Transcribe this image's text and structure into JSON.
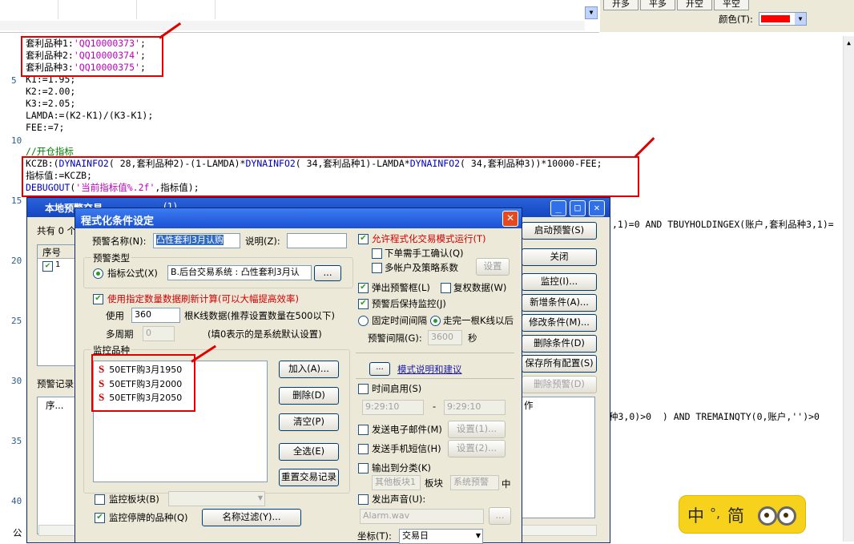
{
  "top_tabs": [
    "开多",
    "平多",
    "开空",
    "平空"
  ],
  "color_label": "颜色(T):",
  "colors": {
    "code_string": "#c000c0",
    "code_func": "#0000c0",
    "code_comment": "#008000",
    "annotation": "#e00000",
    "color_swatch": "#ff0000"
  },
  "line_numbers": [
    "5",
    "10",
    "15",
    "20",
    "25",
    "30",
    "35",
    "40"
  ],
  "code_lines": [
    [
      {
        "t": "套利品种1:"
      },
      {
        "t": "'QQ10000373'",
        "c": "str"
      },
      {
        "t": ";"
      }
    ],
    [
      {
        "t": "套利品种2:"
      },
      {
        "t": "'QQ10000374'",
        "c": "str"
      },
      {
        "t": ";"
      }
    ],
    [
      {
        "t": "套利品种3:"
      },
      {
        "t": "'QQ10000375'",
        "c": "str"
      },
      {
        "t": ";"
      }
    ],
    [
      {
        "t": "K1:=1.95;"
      }
    ],
    [
      {
        "t": "K2:=2.00;"
      }
    ],
    [
      {
        "t": "K3:=2.05;"
      }
    ],
    [
      {
        "t": "LAMDA:=(K2-K1)/(K3-K1);"
      }
    ],
    [
      {
        "t": "FEE:=7;"
      }
    ],
    [
      {
        "t": ""
      }
    ],
    [
      {
        "t": "//开仓指标",
        "c": "cm"
      }
    ],
    [
      {
        "t": "KCZB:("
      },
      {
        "t": "DYNAINFO2",
        "c": "fn"
      },
      {
        "t": "( 28,套利品种2)-(1-LAMDA)*"
      },
      {
        "t": "DYNAINFO2",
        "c": "fn"
      },
      {
        "t": "( 34,套利品种1)-LAMDA*"
      },
      {
        "t": "DYNAINFO2",
        "c": "fn"
      },
      {
        "t": "( 34,套利品种3))*10000-FEE;"
      }
    ],
    [
      {
        "t": "指标值:=KCZB;"
      }
    ],
    [
      {
        "t": "DEBUGOUT",
        "c": "fn"
      },
      {
        "t": "("
      },
      {
        "t": "'当前指标值%.2f'",
        "c": "str"
      },
      {
        "t": ",指标值);"
      }
    ]
  ],
  "code_right_1": ",1)=0 AND TBUYHOLDINGEX(账户,套利品种3,1)=",
  "code_right_2": "种3,0)>0  ) AND TREMAINQTY(0,账户,'')>0",
  "back_window": {
    "title": "本地预警交易",
    "title_tail": "(1)",
    "total_label": "共有 0 个",
    "col_seq": "序号",
    "row1": "1",
    "record_label": "预警记录",
    "rec_col": "序...",
    "action_col": "作",
    "bottom_label": "公",
    "buttons": [
      "启动预警(S)",
      "关闭",
      "监控(I)...",
      "新增条件(A)...",
      "修改条件(M)...",
      "删除条件(D)",
      "保存所有配置(S)",
      "删除预警(D)"
    ]
  },
  "dialog": {
    "title": "程式化条件设定",
    "name_label": "预警名称(N):",
    "name_value": "凸性套利3月认购",
    "desc_label": "说明(Z):",
    "desc_value": "",
    "type_group": "预警类型",
    "formula_label": "指标公式(X)",
    "formula_value": "B.后台交易系统 : 凸性套利3月认",
    "dots": "...",
    "use_data_label": "使用指定数量数据刷新计算(可以大幅提高效率)",
    "use_label": "使用",
    "use_value": "360",
    "use_hint": "根K线数据(推荐设置数量在500以下)",
    "multi_period_label": "多周期",
    "multi_period_value": "0",
    "multi_period_hint": "(填0表示的是系统默认设置)",
    "monitor_group": "监控品种",
    "monitor_items": [
      "50ETF购3月1950",
      "50ETF购3月2000",
      "50ETF购3月2050"
    ],
    "btn_add": "加入(A)...",
    "btn_delete": "删除(D)",
    "btn_clear": "清空(P)",
    "btn_select_all": "全选(E)",
    "btn_reset": "重置交易记录",
    "monitor_block_label": "监控板块(B)",
    "monitor_suspended_label": "监控停牌的品种(Q)",
    "name_filter": "名称过滤(Y)...",
    "allow_prog": "允许程式化交易模式运行(T)",
    "manual_confirm": "下单需手工确认(Q)",
    "multi_account": "多帐户及策略系数",
    "btn_settings": "设置",
    "popup_alert": "弹出预警框(L)",
    "copy_data": "复权数据(W)",
    "keep_monitor": "预警后保持监控(J)",
    "fixed_interval": "固定时间间隔",
    "after_kline": "走完一根K线以后",
    "alert_interval_label": "预警间隔(G):",
    "alert_interval_value": "3600",
    "seconds": "秒",
    "mode_btn": "...",
    "mode_link": "模式说明和建议",
    "time_enable": "时间启用(S)",
    "time_from": "9:29:10",
    "time_to": "9:29:10",
    "dash": "-",
    "send_email": "发送电子邮件(M)",
    "email_settings": "设置(1)...",
    "send_sms": "发送手机短信(H)",
    "sms_settings": "设置(2)...",
    "output_category": "输出到分类(K)",
    "other_block": "其他板块1",
    "block_label": "板块",
    "system_alert": "系统预警",
    "middle_char": "中",
    "play_sound": "发出声音(U):",
    "sound_file": "Alarm.wav",
    "period_label": "坐标(T):",
    "period_value": "交易日"
  },
  "ime": {
    "lang": "中",
    "punct": "°,",
    "mode": "简"
  }
}
